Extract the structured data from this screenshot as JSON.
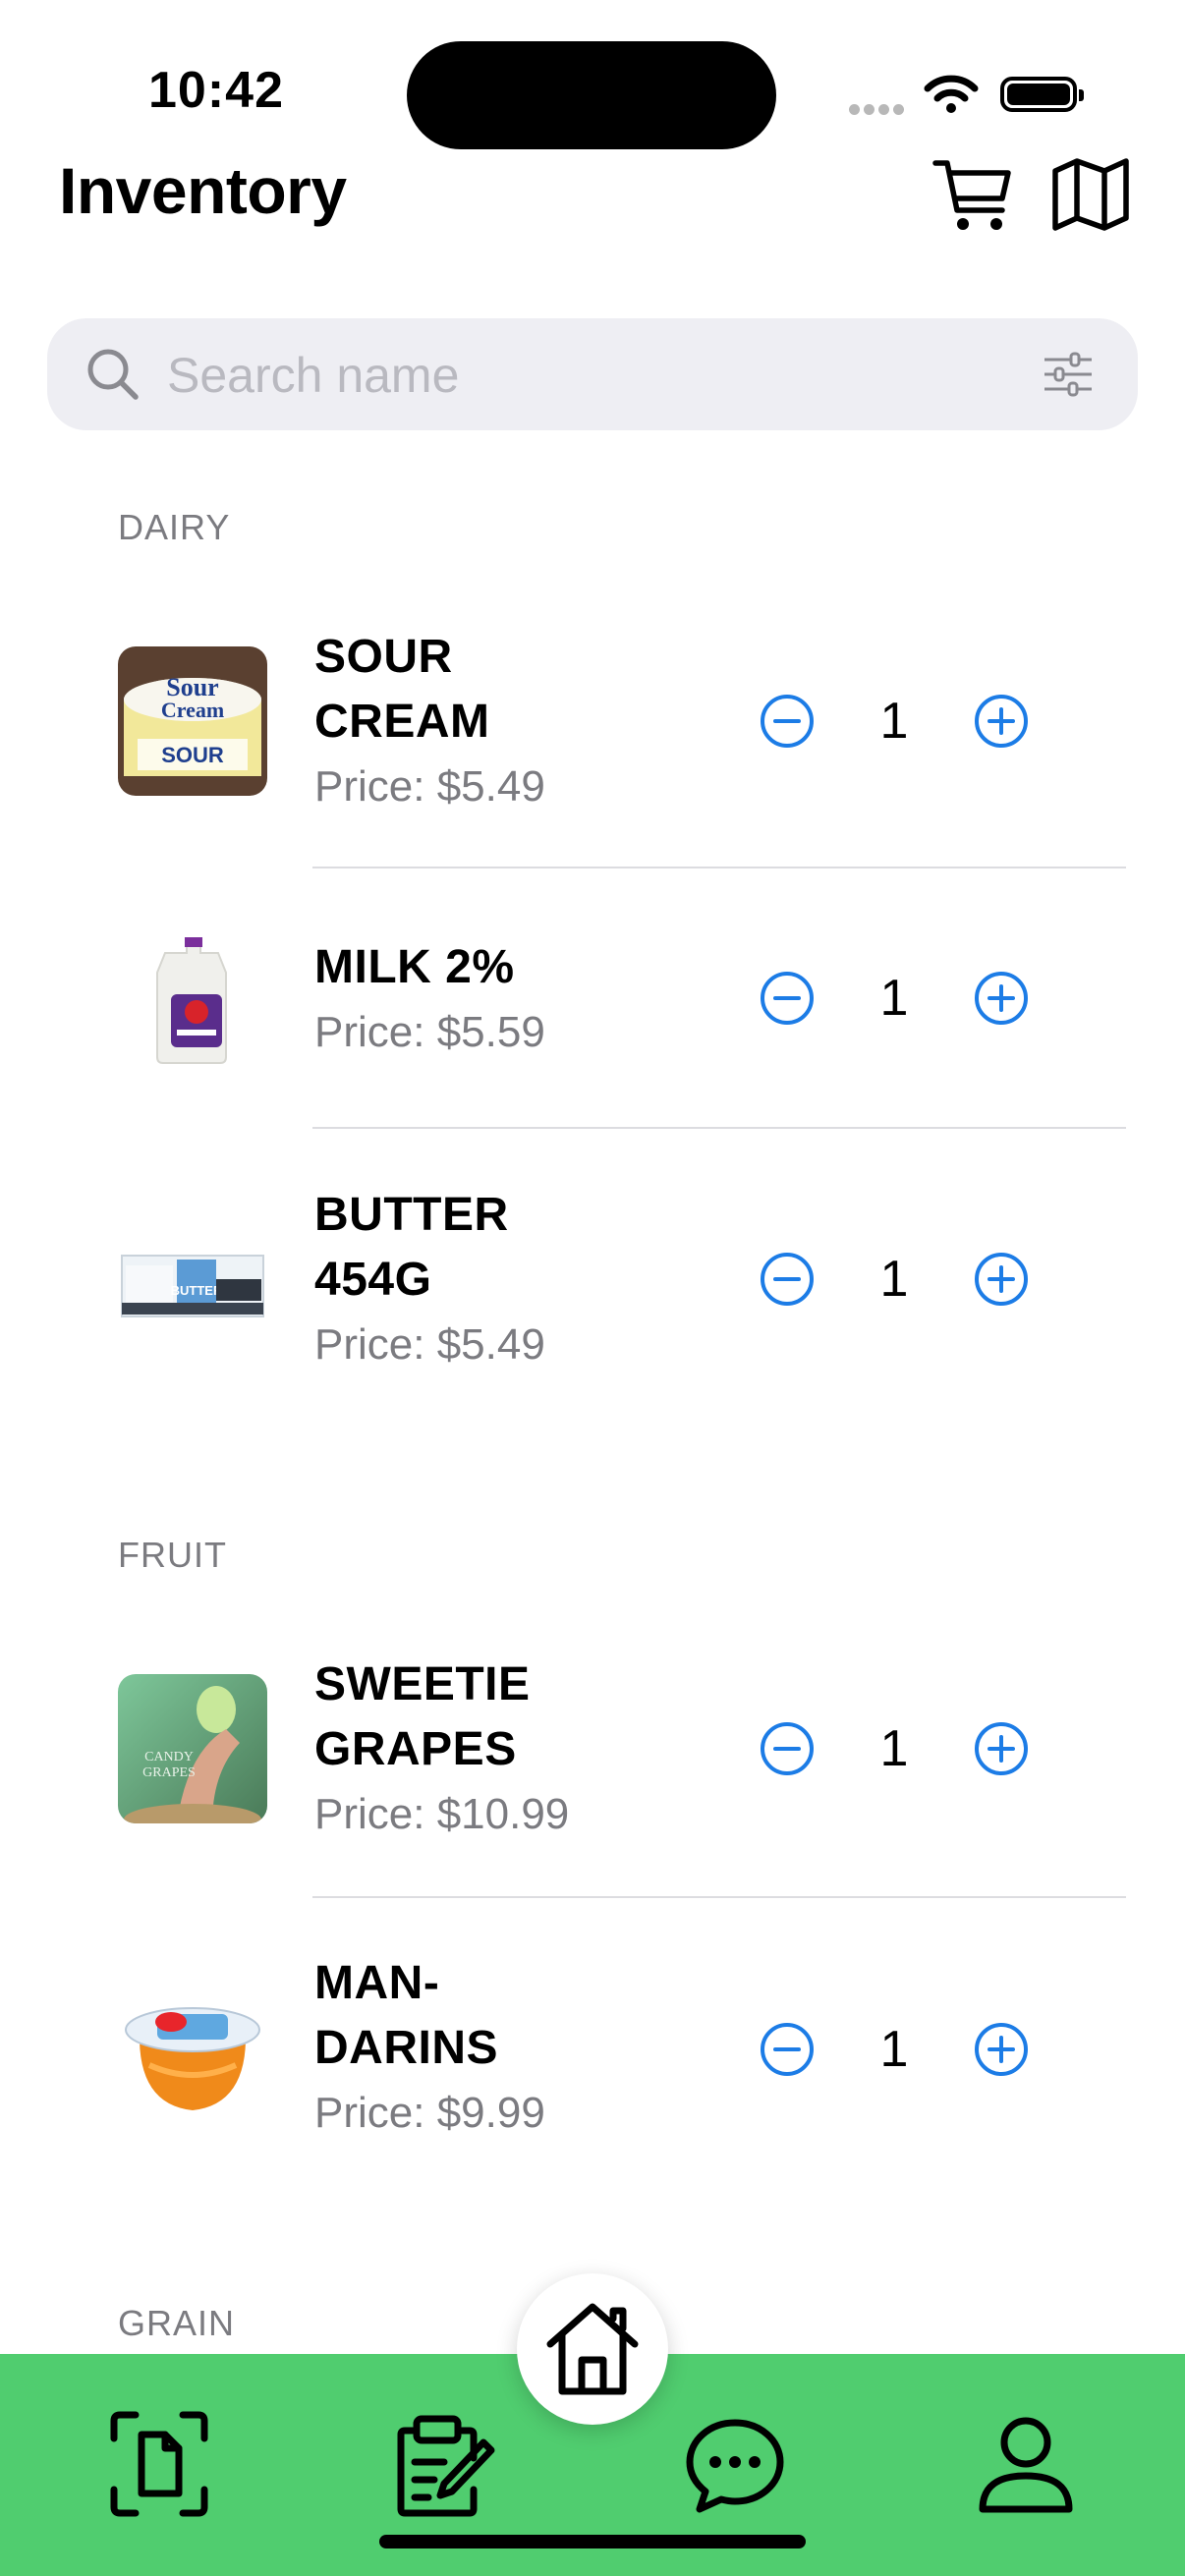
{
  "status_bar": {
    "time": "10:42"
  },
  "header": {
    "title": "Inventory",
    "cart_icon": "cart-icon",
    "map_icon": "map-icon"
  },
  "search": {
    "placeholder": "Search name",
    "value": "",
    "filter_icon": "sliders-icon"
  },
  "sections": [
    {
      "name": "DAIRY",
      "items": [
        {
          "name": "SOUR CREAM",
          "price": "Price: $5.49",
          "qty": "1"
        },
        {
          "name": "MILK 2%",
          "price": "Price: $5.59",
          "qty": "1"
        },
        {
          "name": "BUTTER 454G",
          "price": "Price: $5.49",
          "qty": "1"
        }
      ]
    },
    {
      "name": "FRUIT",
      "items": [
        {
          "name": "SWEETIE GRAPES",
          "price": "Price: $10.99",
          "qty": "1"
        },
        {
          "name": "MAN-DARINS",
          "price": "Price: $9.99",
          "qty": "1"
        }
      ]
    },
    {
      "name": "GRAIN",
      "items": []
    }
  ],
  "tab_bar": {
    "tabs": [
      "scan-document-icon",
      "notes-edit-icon",
      "chat-bubble-icon",
      "profile-icon"
    ],
    "center": "home-icon"
  },
  "colors": {
    "accent": "#1c7ce6",
    "tab_bar": "#50cd6f",
    "secondary_text": "#7b7b80"
  }
}
